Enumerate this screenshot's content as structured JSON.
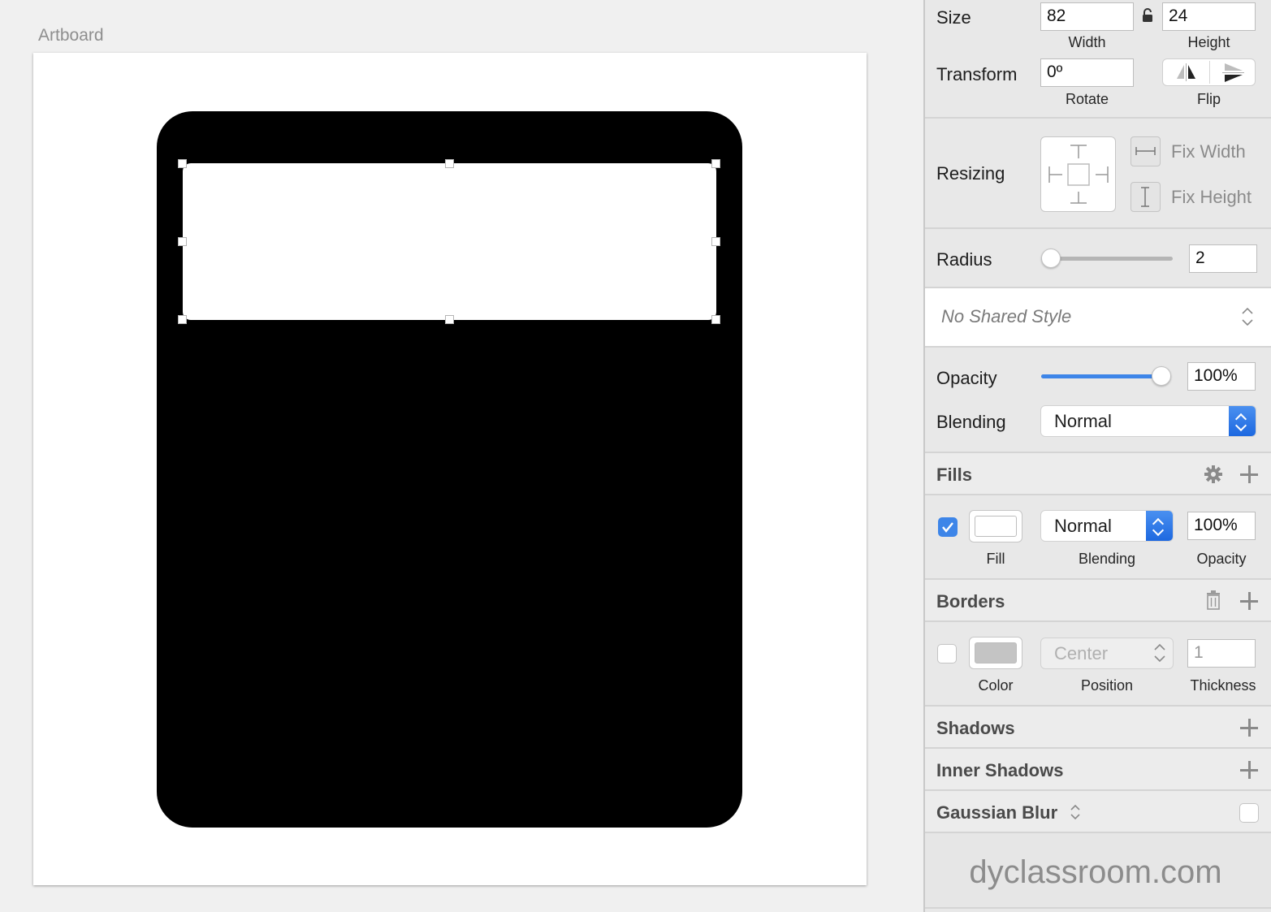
{
  "canvas": {
    "artboard_label": "Artboard",
    "colors": {
      "outer_shape": "#000000",
      "inner_shape": "#ffffff"
    }
  },
  "inspector": {
    "size": {
      "label": "Size",
      "width_value": "82",
      "width_label": "Width",
      "height_value": "24",
      "height_label": "Height",
      "lock_icon": "unlocked-padlock-icon"
    },
    "transform": {
      "label": "Transform",
      "rotate_value": "0º",
      "rotate_label": "Rotate",
      "flip_label": "Flip"
    },
    "resizing": {
      "label": "Resizing",
      "fix_width": "Fix Width",
      "fix_height": "Fix Height"
    },
    "radius": {
      "label": "Radius",
      "value": "2",
      "slider_fraction": 0.07
    },
    "shared_style": {
      "value": "No Shared Style"
    },
    "opacity": {
      "label": "Opacity",
      "value": "100%",
      "slider_fraction": 1.0
    },
    "blending": {
      "label": "Blending",
      "value": "Normal"
    },
    "fills": {
      "header": "Fills",
      "enabled": true,
      "color": "#ffffff",
      "blending_value": "Normal",
      "opacity_value": "100%",
      "fill_label": "Fill",
      "blending_label": "Blending",
      "opacity_label": "Opacity"
    },
    "borders": {
      "header": "Borders",
      "enabled": false,
      "color": "#c4c4c4",
      "position_value": "Center",
      "thickness_value": "1",
      "color_label": "Color",
      "position_label": "Position",
      "thickness_label": "Thickness"
    },
    "shadows": {
      "header": "Shadows"
    },
    "inner_shadows": {
      "header": "Inner Shadows"
    },
    "gaussian_blur": {
      "header": "Gaussian Blur",
      "enabled": false
    },
    "watermark": "dyclassroom.com"
  },
  "accent_color": "#3d85e8"
}
